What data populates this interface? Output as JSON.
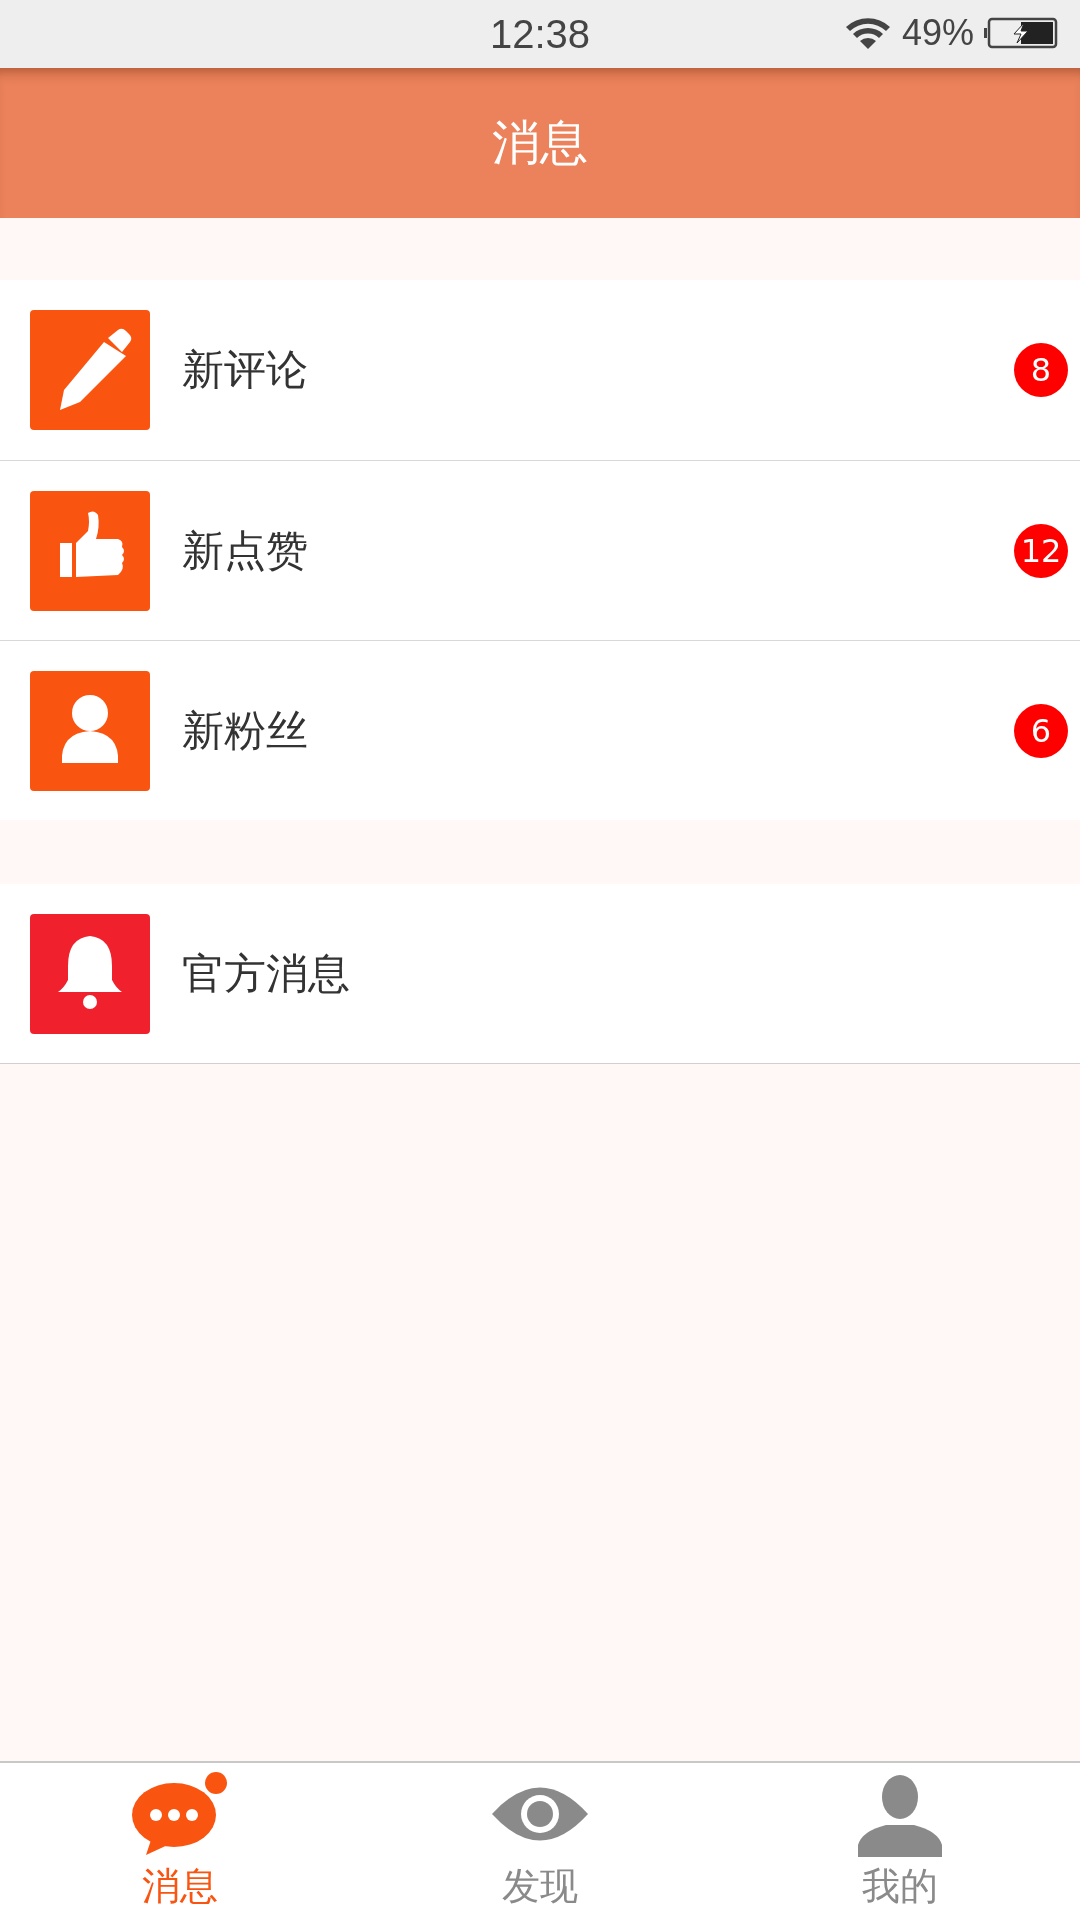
{
  "status_bar": {
    "time": "12:38",
    "battery": "49%"
  },
  "header": {
    "title": "消息"
  },
  "sections": [
    {
      "rows": [
        {
          "kind": "pencil",
          "color": "#fa5411",
          "label": "新评论",
          "badge": "8"
        },
        {
          "kind": "thumb",
          "color": "#fa5411",
          "label": "新点赞",
          "badge": "12"
        },
        {
          "kind": "person",
          "color": "#fa5411",
          "label": "新粉丝",
          "badge": "6"
        }
      ]
    },
    {
      "rows": [
        {
          "kind": "bell",
          "color": "#f0212d",
          "label": "官方消息"
        }
      ]
    }
  ],
  "tabs": [
    {
      "kind": "chat",
      "label": "消息",
      "selected": true
    },
    {
      "kind": "eye",
      "label": "发现",
      "selected": false
    },
    {
      "kind": "person",
      "label": "我的",
      "selected": false
    }
  ]
}
